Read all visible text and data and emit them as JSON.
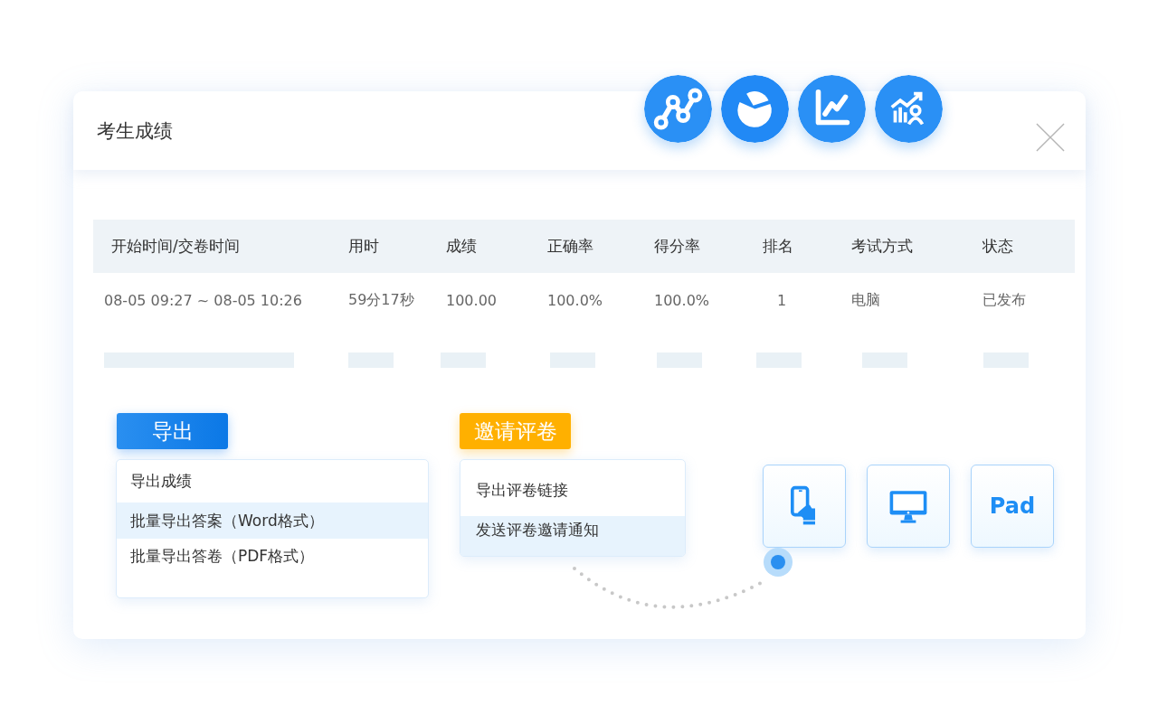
{
  "window": {
    "title": "考生成绩"
  },
  "table": {
    "columns": [
      "开始时间/交卷时间",
      "用时",
      "成绩",
      "正确率",
      "得分率",
      "排名",
      "考试方式",
      "状态"
    ],
    "rows": [
      [
        "08-05 09:27 ~ 08-05 10:26",
        "59分17秒",
        "100.00",
        "100.0%",
        "100.0%",
        "1",
        "电脑",
        "已发布"
      ]
    ]
  },
  "export": {
    "button": "导出",
    "items": [
      {
        "label": "导出成绩",
        "selected": false
      },
      {
        "label": "批量导出答案（Word格式）",
        "selected": true
      },
      {
        "label": "批量导出答卷（PDF格式）",
        "selected": false
      }
    ]
  },
  "invite": {
    "button": "邀请评卷",
    "items": [
      {
        "label": "导出评卷链接",
        "selected": false
      },
      {
        "label": "发送评卷邀请通知",
        "selected": true
      }
    ]
  },
  "devices": [
    {
      "kind": "phone"
    },
    {
      "kind": "desktop"
    },
    {
      "kind": "label",
      "label": "Pad"
    }
  ]
}
